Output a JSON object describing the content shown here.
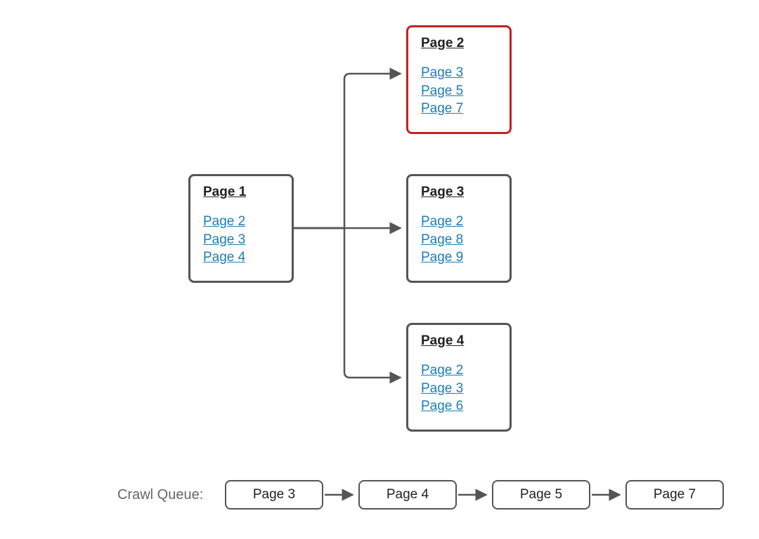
{
  "pages": {
    "p1": {
      "title": "Page 1",
      "links": [
        "Page 2",
        "Page 3",
        "Page 4"
      ],
      "highlight": false
    },
    "p2": {
      "title": "Page 2",
      "links": [
        "Page 3",
        "Page 5",
        "Page 7"
      ],
      "highlight": true
    },
    "p3": {
      "title": "Page 3",
      "links": [
        "Page 2",
        "Page 8",
        "Page 9"
      ],
      "highlight": false
    },
    "p4": {
      "title": "Page 4",
      "links": [
        "Page 2",
        "Page 3",
        "Page 6"
      ],
      "highlight": false
    }
  },
  "queue": {
    "label": "Crawl Queue:",
    "items": [
      "Page 3",
      "Page 4",
      "Page 5",
      "Page 7"
    ]
  },
  "colors": {
    "border": "#555",
    "highlight": "#c82020",
    "link": "#1a7db8"
  }
}
